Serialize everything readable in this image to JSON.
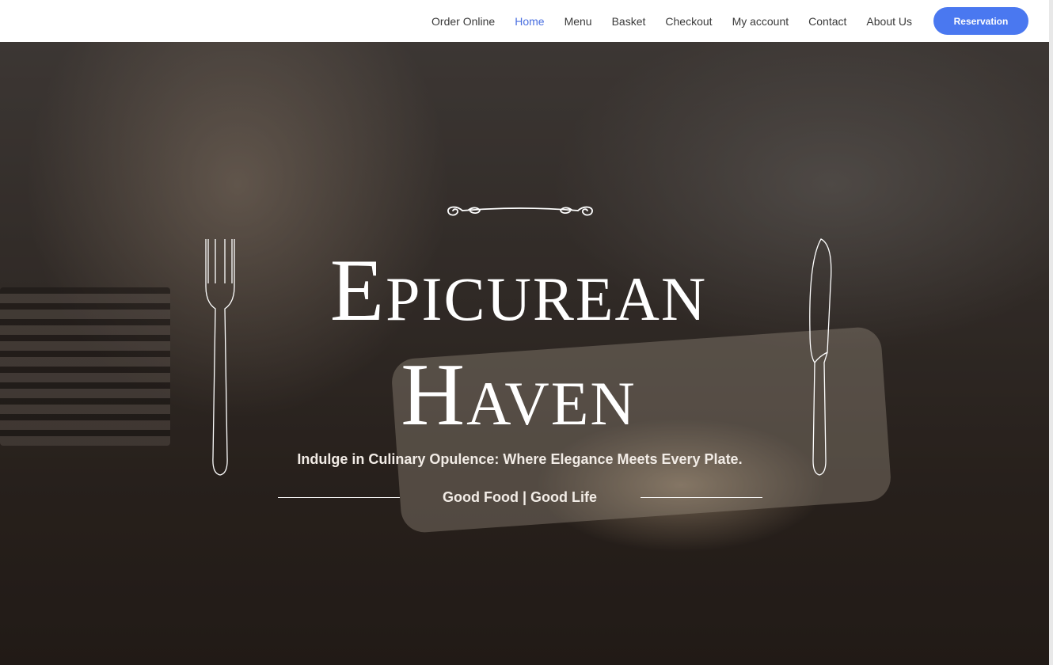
{
  "nav": {
    "items": [
      {
        "label": "Order Online",
        "active": false
      },
      {
        "label": "Home",
        "active": true
      },
      {
        "label": "Menu",
        "active": false
      },
      {
        "label": "Basket",
        "active": false
      },
      {
        "label": "Checkout",
        "active": false
      },
      {
        "label": "My account",
        "active": false
      },
      {
        "label": "Contact",
        "active": false
      },
      {
        "label": "About Us",
        "active": false
      }
    ],
    "reservation_label": "Reservation"
  },
  "hero": {
    "title_line1": "Epicurean",
    "title_line2": "Haven",
    "tagline": "Indulge in Culinary Opulence: Where Elegance Meets Every Plate.",
    "motto": "Good Food | Good Life",
    "decor_icons": [
      "flourish-ornament",
      "fork-icon",
      "knife-icon"
    ]
  },
  "colors": {
    "accent": "#4a78f0",
    "nav_active": "#4a6fe0",
    "nav_text": "#3a3a3a",
    "hero_text": "#ffffff"
  }
}
